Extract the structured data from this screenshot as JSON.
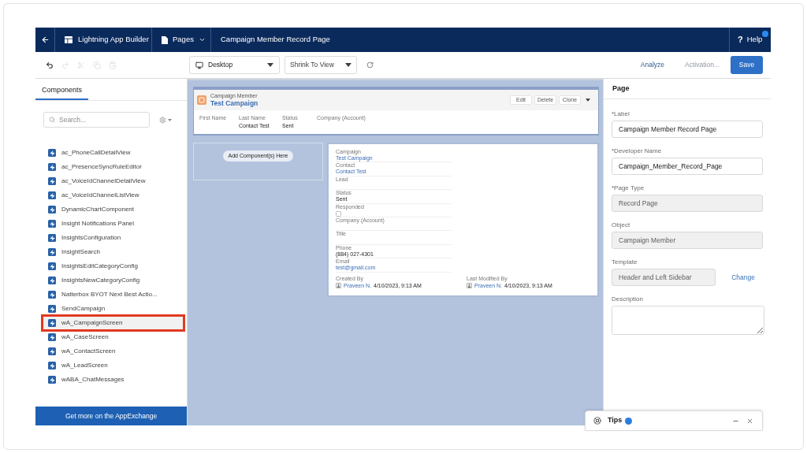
{
  "nav": {
    "app_name": "Lightning App Builder",
    "pages_menu": "Pages",
    "page_title": "Campaign Member Record Page",
    "help": {
      "symbol": "?",
      "label": "Help"
    }
  },
  "toolbar": {
    "actions": [
      {
        "kind": "undo",
        "disabled": false
      },
      {
        "kind": "redo",
        "disabled": true
      },
      {
        "kind": "cut",
        "disabled": true
      },
      {
        "kind": "copy",
        "disabled": true
      },
      {
        "kind": "paste",
        "disabled": true
      }
    ],
    "device": "Desktop",
    "zoom": "Shrink To View",
    "analyze": "Analyze",
    "activation": {
      "label": "Activation...",
      "disabled": true
    },
    "save": "Save"
  },
  "components_panel": {
    "tabs": [
      {
        "label": "Components",
        "selected": true
      }
    ],
    "search": {
      "placeholder": "Search..."
    },
    "items": [
      {
        "label": "ac_PhoneCallDetailView",
        "highlighted": false
      },
      {
        "label": "ac_PresenceSyncRuleEditor",
        "highlighted": false
      },
      {
        "label": "ac_VoiceIdChannelDetailView",
        "highlighted": false
      },
      {
        "label": "ac_VoiceIdChannelListView",
        "highlighted": false
      },
      {
        "label": "DynamicChartComponent",
        "highlighted": false
      },
      {
        "label": "Insight Notifications Panel",
        "highlighted": false
      },
      {
        "label": "InsightsConfiguration",
        "highlighted": false
      },
      {
        "label": "InsightSearch",
        "highlighted": false
      },
      {
        "label": "InsightsEditCategoryConfig",
        "highlighted": false
      },
      {
        "label": "InsightsNewCategoryConfig",
        "highlighted": false
      },
      {
        "label": "Natterbox BYOT Next Best Actio...",
        "highlighted": false
      },
      {
        "label": "SendCampaign",
        "highlighted": false
      },
      {
        "label": "wA_CampaignScreen",
        "highlighted": true
      },
      {
        "label": "wA_CaseScreen",
        "highlighted": false
      },
      {
        "label": "wA_ContactScreen",
        "highlighted": false
      },
      {
        "label": "wA_LeadScreen",
        "highlighted": false
      },
      {
        "label": "wABA_ChatMessages",
        "highlighted": false
      }
    ],
    "appexchange_button": "Get more on the AppExchange"
  },
  "canvas": {
    "header": {
      "object": "Campaign Member",
      "title": "Test Campaign",
      "actions": [
        "Edit",
        "Delete",
        "Clone"
      ],
      "highlights": [
        {
          "label": "First Name"
        },
        {
          "label": "Last Name",
          "value": "Contact Test"
        },
        {
          "label": "Status",
          "value": "Sent"
        },
        {
          "label": "Company (Account)"
        }
      ]
    },
    "sidebar_placeholder": "Add Component(s) Here",
    "details": {
      "fields": [
        {
          "label": "Campaign",
          "value": "Test Campaign",
          "kind": "link"
        },
        {
          "label": "Contact",
          "value": "Contact Test",
          "kind": "link"
        },
        {
          "label": "Lead",
          "kind": "text"
        },
        {
          "label": "Status",
          "value": "Sent",
          "kind": "text"
        },
        {
          "label": "Responded",
          "kind": "checkbox",
          "checked": false
        },
        {
          "label": "Company (Account)",
          "kind": "text"
        },
        {
          "label": "Title",
          "kind": "text"
        },
        {
          "label": "Phone",
          "value": "(884) 027-4301",
          "kind": "text"
        },
        {
          "label": "Email",
          "value": "test@gmail.com",
          "kind": "link"
        }
      ],
      "system": [
        {
          "label": "Created By",
          "user": "Praveen N.",
          "date": "4/10/2023, 9:13 AM"
        },
        {
          "label": "Last Modified By",
          "user": "Praveen N.",
          "date": "4/10/2023, 9:13 AM"
        }
      ]
    }
  },
  "properties": {
    "title": "Page",
    "fields": [
      {
        "label": "*Label",
        "value": "Campaign Member Record Page",
        "kind": "input",
        "disabled": false
      },
      {
        "label": "*Developer Name",
        "value": "Campaign_Member_Record_Page",
        "kind": "input",
        "disabled": false
      },
      {
        "label": "*Page Type",
        "value": "Record Page",
        "kind": "input",
        "disabled": true
      },
      {
        "label": "Object",
        "value": "Campaign Member",
        "kind": "input",
        "disabled": true
      },
      {
        "label": "Template",
        "value": "Header and Left Sidebar",
        "kind": "input",
        "disabled": true,
        "action": "Change"
      },
      {
        "label": "Description",
        "kind": "textarea",
        "disabled": false
      }
    ]
  },
  "tips": {
    "label": "Tips"
  }
}
